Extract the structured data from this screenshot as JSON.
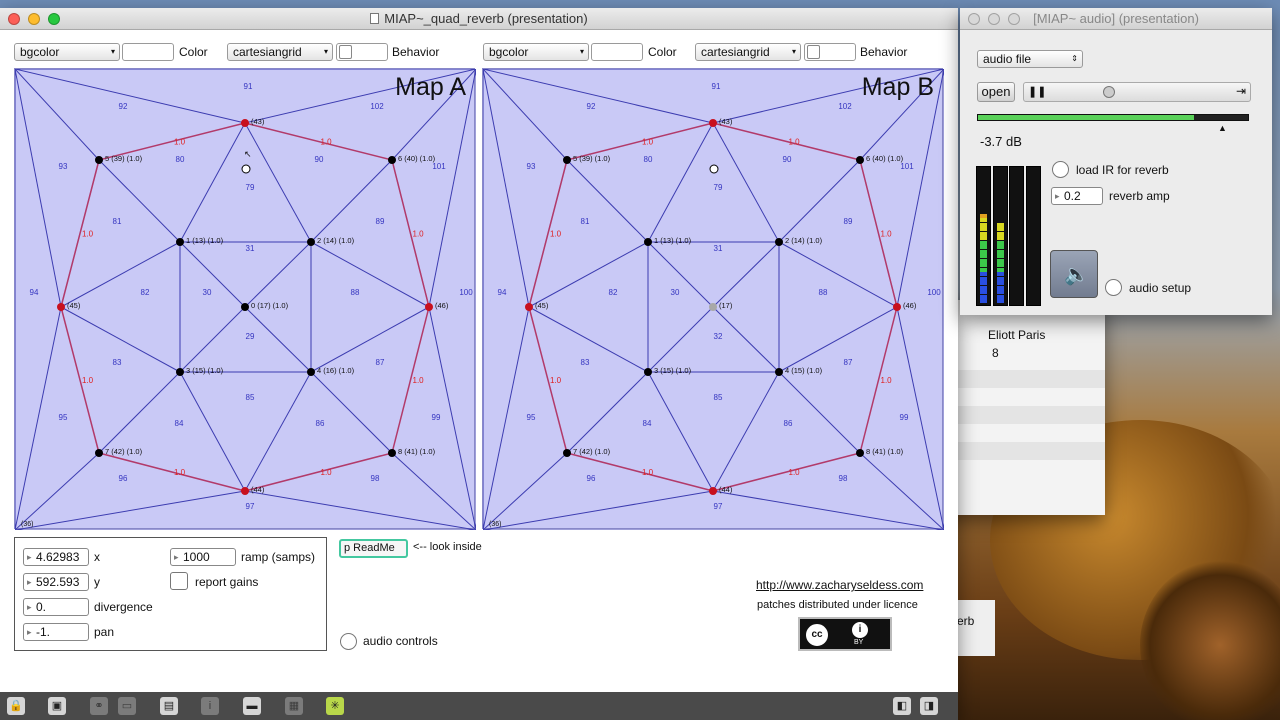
{
  "left_window": {
    "title": "MIAP~_quad_reverb (presentation)",
    "maps": [
      {
        "title": "Map A",
        "color_menu": "bgcolor",
        "color_label": "Color",
        "behavior_menu": "cartesiangrid",
        "behavior_label": "Behavior",
        "top_label": "91",
        "regions": [
          "92",
          "102",
          "80",
          "90",
          "93",
          "101",
          "79",
          "81",
          "89",
          "31",
          "82",
          "30",
          "88",
          "29",
          "83",
          "87",
          "85",
          "84",
          "86",
          "95",
          "99",
          "96",
          "98",
          "97",
          "94",
          "100"
        ],
        "nodes": [
          "(43)",
          "5 (39) (1.0)",
          "6 (40) (1.0)",
          "1 (13) (1.0)",
          "2 (14) (1.0)",
          "(45)",
          "0 (17) (1.0)",
          "(46)",
          "3 (15) (1.0)",
          "4 (16) (1.0)",
          "7 (42) (1.0)",
          "8 (41) (1.0)",
          "(44)",
          "(36)"
        ],
        "edge_weights": [
          "1.0",
          "1.0",
          "1.0",
          "1.0",
          "1.0",
          "1.0",
          "1.0",
          "1.0"
        ]
      },
      {
        "title": "Map B",
        "color_menu": "bgcolor",
        "color_label": "Color",
        "behavior_menu": "cartesiangrid",
        "behavior_label": "Behavior",
        "top_label": "91",
        "regions": [
          "92",
          "102",
          "80",
          "90",
          "93",
          "101",
          "79",
          "81",
          "89",
          "31",
          "82",
          "30",
          "88",
          "32",
          "83",
          "87",
          "85",
          "84",
          "86",
          "95",
          "99",
          "96",
          "98",
          "97",
          "94",
          "100"
        ],
        "nodes": [
          "(43)",
          "5 (39) (1.0)",
          "6 (40) (1.0)",
          "1 (13) (1.0)",
          "2 (14) (1.0)",
          "(45)",
          "(17)",
          "(46)",
          "3 (15) (1.0)",
          "4 (15) (1.0)",
          "7 (42) (1.0)",
          "8 (41) (1.0)",
          "(44)",
          "(36)"
        ],
        "edge_weights": [
          "1.0",
          "1.0",
          "1.0",
          "1.0",
          "1.0",
          "1.0",
          "1.0",
          "1.0"
        ]
      }
    ],
    "controls": {
      "x_value": "4.62983",
      "x_label": "x",
      "y_value": "592.593",
      "y_label": "y",
      "divergence_value": "0.",
      "divergence_label": "divergence",
      "pan_value": "-1.",
      "pan_label": "pan",
      "ramp_value": "1000",
      "ramp_label": "ramp (samps)",
      "report_gains_label": "report gains"
    },
    "readme_button": "p ReadMe",
    "readme_hint": "<-- look inside",
    "audio_controls_label": "audio controls",
    "url": "http://www.zacharyseldess.com",
    "licence_text": "patches distributed under licence",
    "cc_badge": "cc",
    "cc_badge_by": "BY"
  },
  "right_window": {
    "title": "[MIAP~ audio] (presentation)",
    "source_menu": "audio file",
    "open_button": "open",
    "level_db": "-3.7 dB",
    "load_ir_label": "load IR for reverb",
    "reverb_amp_value": "0.2",
    "reverb_amp_label": "reverb amp",
    "audio_setup_label": "audio setup",
    "playback_position": 0.35,
    "gain_fraction": 0.8,
    "meter_levels": [
      0.65,
      0.6,
      0,
      0
    ]
  },
  "background_window": {
    "text_lines": [
      "Eliott Paris",
      "8"
    ],
    "partial_label": "erb"
  }
}
